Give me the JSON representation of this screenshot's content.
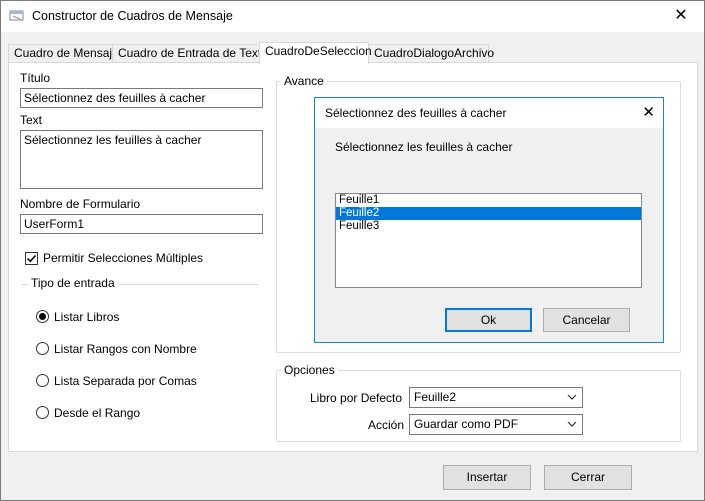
{
  "window": {
    "title": "Constructor de Cuadros de Mensaje",
    "close_glyph": "✕"
  },
  "tabs": [
    {
      "label": "Cuadro de Mensaje"
    },
    {
      "label": "Cuadro de Entrada de Texto"
    },
    {
      "label": "CuadroDeSeleccion"
    },
    {
      "label": "CuadroDialogoArchivo"
    }
  ],
  "active_tab_index": 2,
  "form": {
    "title_label": "Título",
    "title_value": "Sélectionnez des feuilles à cacher",
    "text_label": "Text",
    "text_value": "Sélectionnez les feuilles à cacher",
    "form_name_label": "Nombre de Formulario",
    "form_name_value": "UserForm1",
    "multi_select_label": "Permitir Selecciones Múltiples",
    "multi_select_checked": true
  },
  "input_type": {
    "legend": "Tipo de entrada",
    "options": [
      {
        "label": "Listar Libros",
        "selected": true
      },
      {
        "label": "Listar Rangos con Nombre",
        "selected": false
      },
      {
        "label": "Lista Separada por Comas",
        "selected": false
      },
      {
        "label": "Desde el Rango",
        "selected": false
      }
    ]
  },
  "preview": {
    "legend": "Avance",
    "dialog_title": "Sélectionnez des feuilles à cacher",
    "close_glyph": "✕",
    "prompt": "Sélectionnez les feuilles à cacher",
    "items": [
      {
        "label": "Feuille1",
        "selected": false
      },
      {
        "label": "Feuille2",
        "selected": true
      },
      {
        "label": "Feuille3",
        "selected": false
      }
    ],
    "ok_label": "Ok",
    "cancel_label": "Cancelar"
  },
  "options": {
    "legend": "Opciones",
    "default_book_label": "Libro por Defecto",
    "default_book_value": "Feuille2",
    "action_label": "Acción",
    "action_value": "Guardar como PDF"
  },
  "footer": {
    "insert_label": "Insertar",
    "close_label": "Cerrar"
  },
  "colors": {
    "accent": "#0078d7",
    "dialog_border": "#1883d7"
  }
}
